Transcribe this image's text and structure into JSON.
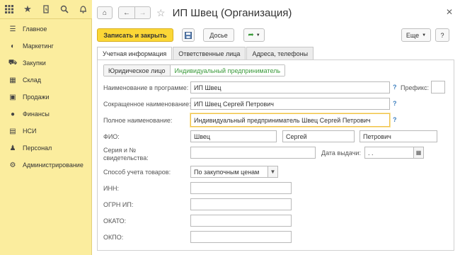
{
  "topbar": {
    "icons": [
      "grid-icon",
      "star-icon",
      "history-icon",
      "search-icon",
      "bell-icon"
    ]
  },
  "sidebar": {
    "items": [
      {
        "label": "Главное",
        "icon": "menu-icon"
      },
      {
        "label": "Маркетинг",
        "icon": "marketing-icon"
      },
      {
        "label": "Закупки",
        "icon": "cart-icon"
      },
      {
        "label": "Склад",
        "icon": "warehouse-icon"
      },
      {
        "label": "Продажи",
        "icon": "briefcase-icon"
      },
      {
        "label": "Финансы",
        "icon": "finance-icon"
      },
      {
        "label": "НСИ",
        "icon": "book-icon"
      },
      {
        "label": "Персонал",
        "icon": "person-icon"
      },
      {
        "label": "Администрирование",
        "icon": "gear-icon"
      }
    ]
  },
  "header": {
    "title": "ИП Швец (Организация)"
  },
  "toolbar": {
    "save_close": "Записать и закрыть",
    "dossier": "Досье",
    "more": "Еще",
    "help": "?"
  },
  "tabs": [
    "Учетная информация",
    "Ответственные лица",
    "Адреса, телефоны"
  ],
  "subtabs": [
    "Юридическое лицо",
    "Индивидуальный предприниматель"
  ],
  "form": {
    "name_label": "Наименование в программе:",
    "name_value": "ИП Швец",
    "prefix_label": "Префикс:",
    "prefix_value": "",
    "short_label": "Сокращенное наименование:",
    "short_value": "ИП Швец Сергей Петрович",
    "full_label": "Полное наименование:",
    "full_value": "Индивидуальный предприниматель Швец Сергей Петрович",
    "fio_label": "ФИО:",
    "surname": "Швец",
    "firstname": "Сергей",
    "patronymic": "Петрович",
    "cert_label_1": "Серия и №",
    "cert_label_2": "свидетельства:",
    "cert_value": "",
    "issue_label": "Дата выдачи:",
    "issue_value": " .  .",
    "goods_label": "Способ учета товаров:",
    "goods_value": "По закупочным ценам",
    "inn_label": "ИНН:",
    "ogrn_label": "ОГРН ИП:",
    "okato_label": "ОКАТО:",
    "okpo_label": "ОКПО:",
    "help_mark": "?"
  },
  "colors": {
    "sidebar_bg": "#fbed9e",
    "primary_button": "#fbd736",
    "active_subtab": "#3b9a3b",
    "help_mark": "#3d7fbf"
  }
}
